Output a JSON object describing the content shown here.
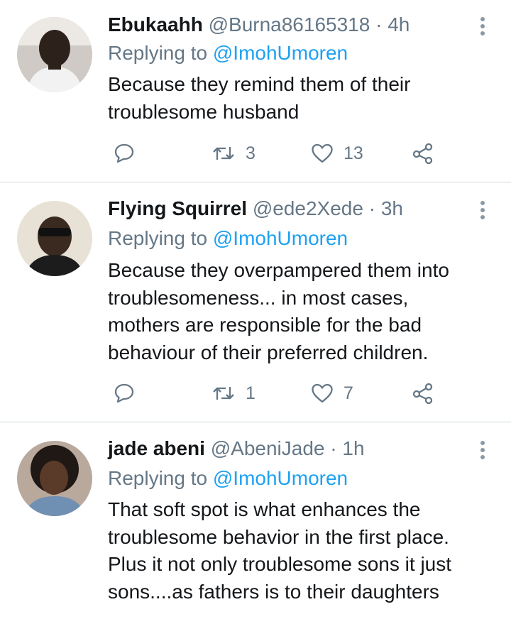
{
  "colors": {
    "accent": "#1da1f2",
    "muted": "#657786",
    "text": "#14171a",
    "divider": "#cfd9de"
  },
  "icons": {
    "reply": "comment-icon",
    "retweet": "retweet-icon",
    "like": "heart-icon",
    "share": "share-icon",
    "more": "more-vertical-icon"
  },
  "tweets": [
    {
      "name": "Ebukaahh",
      "handle": "@Burna86165318",
      "separator": "·",
      "time": "4h",
      "replying_prefix": "Replying to",
      "replying_to": "@ImohUmoren",
      "lines": [
        "Because they remind them of their",
        "troublesome husband"
      ],
      "retweets": "3",
      "likes": "13"
    },
    {
      "name": "Flying Squirrel",
      "handle": "@ede2Xede",
      "separator": "·",
      "time": "3h",
      "replying_prefix": "Replying to",
      "replying_to": "@ImohUmoren",
      "lines": [
        "Because they overpampered them into",
        "troublesomeness... in most cases,",
        "mothers are responsible for the bad",
        "behaviour of their preferred children."
      ],
      "retweets": "1",
      "likes": "7"
    },
    {
      "name": "jade abeni",
      "handle": "@AbeniJade",
      "separator": "·",
      "time": "1h",
      "replying_prefix": "Replying to",
      "replying_to": "@ImohUmoren",
      "lines": [
        "That soft spot is what enhances the",
        "troublesome behavior in the first place.",
        "Plus it not only troublesome sons it just",
        "sons....as fathers is to their daughters"
      ]
    }
  ]
}
